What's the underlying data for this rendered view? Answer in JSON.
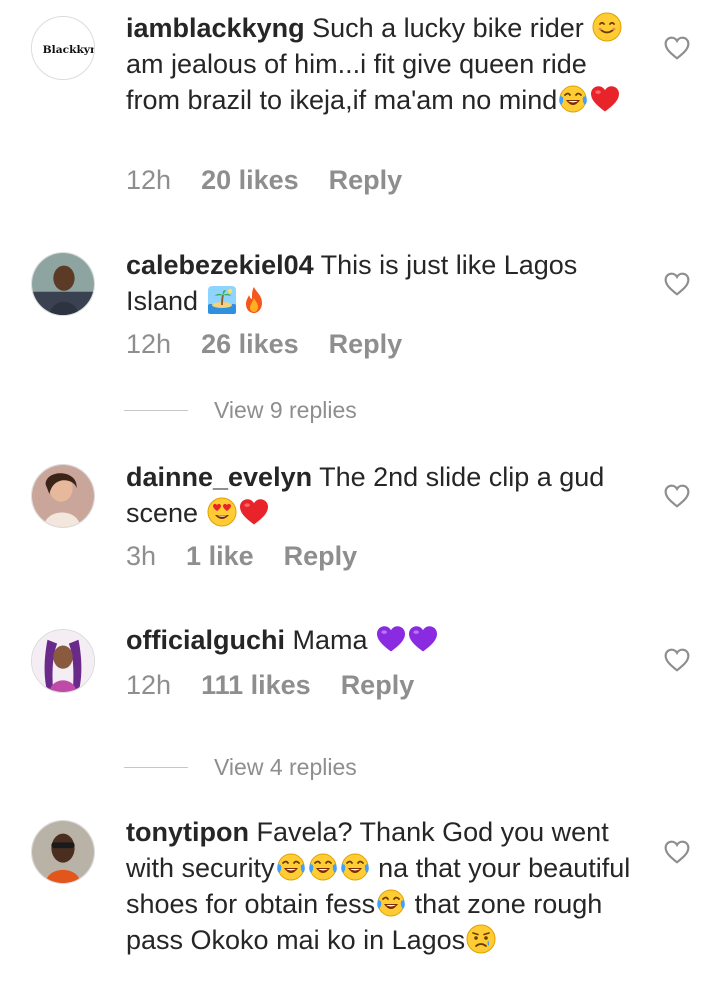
{
  "comments": [
    {
      "username": "iamblackkyng",
      "avatar_text": "Blackkyng",
      "text": "Such a lucky bike rider",
      "text2": "am jealous of him...i fit give queen ride from brazil to ikeja,if ma'am no mind",
      "emojis": [
        "smiling-face-icon",
        "tears-of-joy-icon",
        "red-heart-icon"
      ],
      "time": "12h",
      "likes": "20 likes",
      "reply": "Reply"
    },
    {
      "username": "calebezekiel04",
      "text": "This is just like Lagos Island",
      "emojis": [
        "desert-island-icon",
        "fire-icon"
      ],
      "time": "12h",
      "likes": "26 likes",
      "reply": "Reply",
      "view_replies": "View 9 replies"
    },
    {
      "username": "dainne_evelyn",
      "text": "The 2nd slide clip a gud scene",
      "emojis": [
        "heart-eyes-icon",
        "red-heart-icon"
      ],
      "time": "3h",
      "likes": "1 like",
      "reply": "Reply"
    },
    {
      "username": "officialguchi",
      "text": "Mama",
      "emojis": [
        "purple-heart-icon",
        "purple-heart-icon"
      ],
      "time": "12h",
      "likes": "111 likes",
      "reply": "Reply",
      "view_replies": "View 4 replies"
    },
    {
      "username": "tonytipon",
      "text": "Favela? Thank God you went with security",
      "text2": "na that your beautiful shoes for obtain fess",
      "text3": "that zone rough pass Okoko mai ko in Lagos",
      "emojis": [
        "tears-of-joy-icon",
        "sad-relieved-face-icon"
      ]
    }
  ],
  "colors": {
    "text": "#262626",
    "muted": "#8e8e8e",
    "divider": "#c7c7c7",
    "heart_red": "#e8232a",
    "purple": "#8a2be2"
  }
}
